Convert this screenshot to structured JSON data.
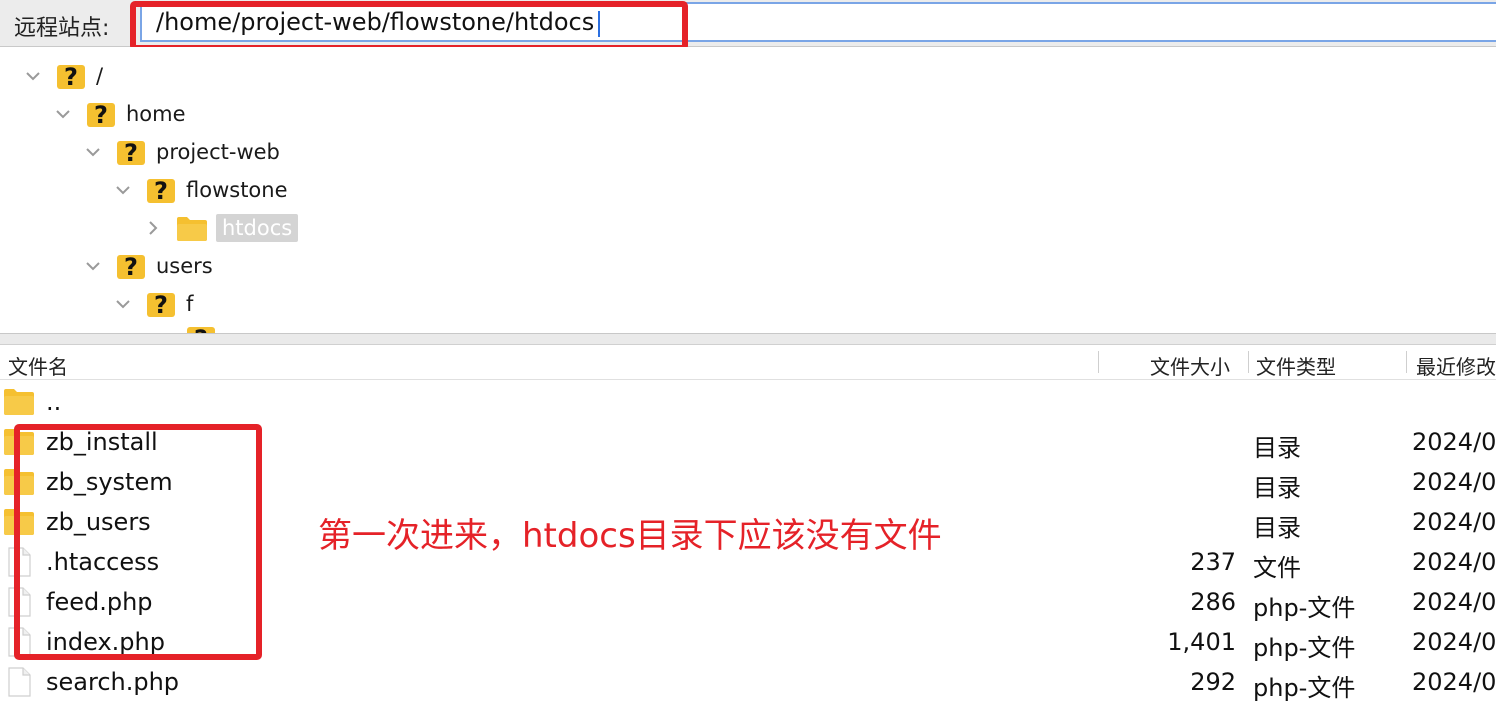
{
  "topbar": {
    "label": "远程站点:",
    "path_value": "/home/project-web/flowstone/htdocs"
  },
  "tree": {
    "nodes": [
      {
        "label": "/",
        "icon": "unknown-folder-icon",
        "expanded": true
      },
      {
        "label": "home",
        "icon": "unknown-folder-icon",
        "expanded": true
      },
      {
        "label": "project-web",
        "icon": "unknown-folder-icon",
        "expanded": true
      },
      {
        "label": "flowstone",
        "icon": "unknown-folder-icon",
        "expanded": true
      },
      {
        "label": "htdocs",
        "icon": "folder-icon",
        "expanded": false,
        "selected": true
      },
      {
        "label": "users",
        "icon": "unknown-folder-icon",
        "expanded": true
      },
      {
        "label": "f",
        "icon": "unknown-folder-icon",
        "expanded": true
      }
    ]
  },
  "file_list": {
    "columns": {
      "name": "文件名",
      "size": "文件大小",
      "type": "文件类型",
      "modified": "最近修改"
    },
    "rows": [
      {
        "name": "..",
        "size": "",
        "type": "",
        "date": "",
        "icon": "folder-icon"
      },
      {
        "name": "zb_install",
        "size": "",
        "type": "目录",
        "date": "2024/0",
        "icon": "folder-icon"
      },
      {
        "name": "zb_system",
        "size": "",
        "type": "目录",
        "date": "2024/0",
        "icon": "folder-icon"
      },
      {
        "name": "zb_users",
        "size": "",
        "type": "目录",
        "date": "2024/0",
        "icon": "folder-icon"
      },
      {
        "name": ".htaccess",
        "size": "237",
        "type": "文件",
        "date": "2024/0",
        "icon": "file-icon"
      },
      {
        "name": "feed.php",
        "size": "286",
        "type": "php-文件",
        "date": "2024/0",
        "icon": "file-icon"
      },
      {
        "name": "index.php",
        "size": "1,401",
        "type": "php-文件",
        "date": "2024/0",
        "icon": "file-icon"
      },
      {
        "name": "search.php",
        "size": "292",
        "type": "php-文件",
        "date": "2024/0",
        "icon": "file-icon"
      }
    ]
  },
  "annotation": {
    "text": "第一次进来，htdocs目录下应该没有文件"
  },
  "colors": {
    "highlight": "#e52228",
    "folder": "#f5c030",
    "focus": "#7aa5e6"
  }
}
